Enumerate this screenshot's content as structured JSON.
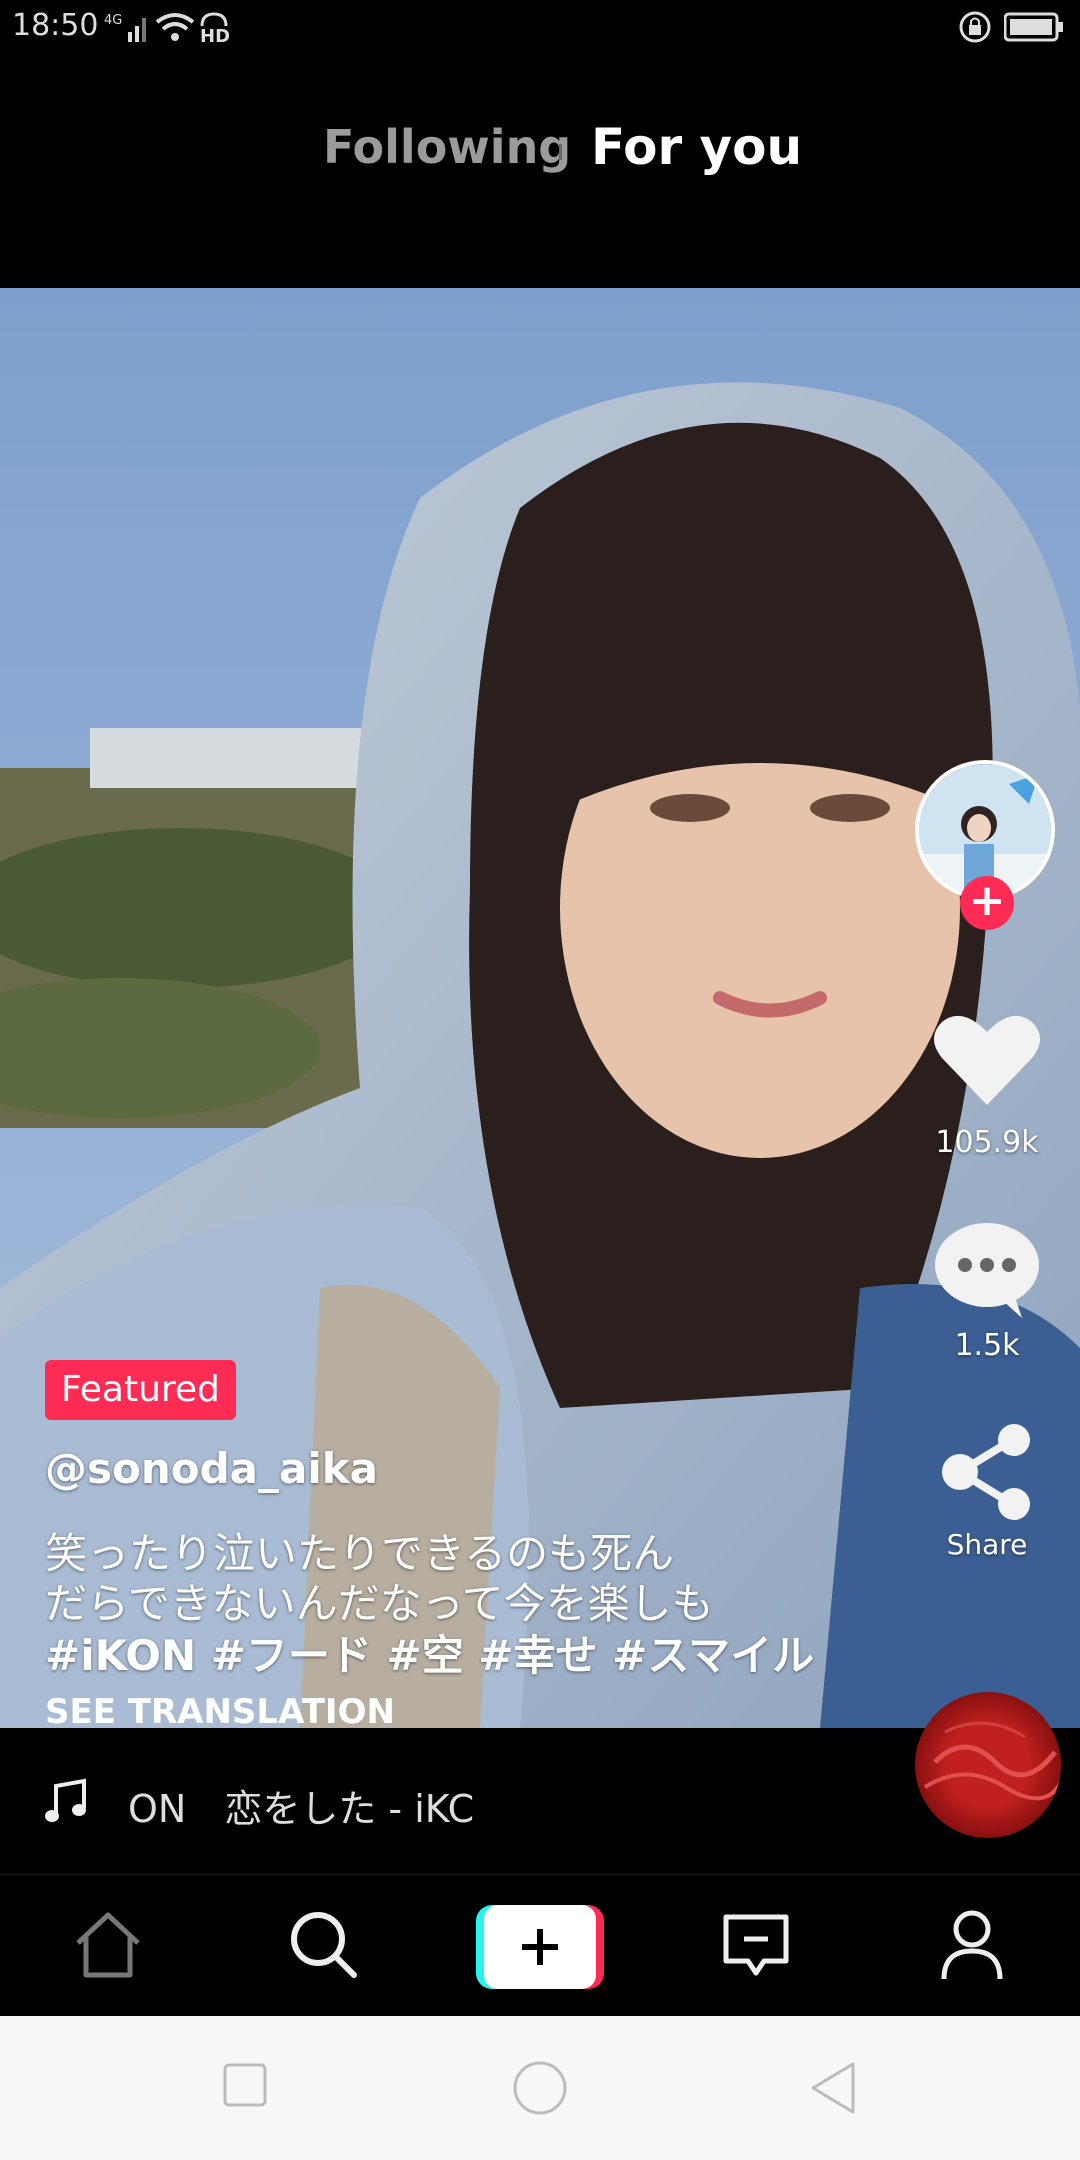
{
  "status_bar": {
    "time": "18:50",
    "signal": "4G",
    "network_badge": "HD",
    "icons": [
      "signal-icon",
      "wifi-icon",
      "hd-icon",
      "rotation-lock-icon",
      "battery-icon"
    ]
  },
  "top_tabs": {
    "following": "Following",
    "for_you": "For you",
    "active": "For you"
  },
  "post": {
    "badge": "Featured",
    "username": "@sonoda_aika",
    "caption_lines": [
      "笑ったり泣いたりできるのも死ん",
      "だらできないんだなって今を楽しも",
      "#iKON #フード #空 #幸せ #スマイル"
    ],
    "see_translation": "SEE TRANSLATION",
    "music": "ON　恋をした - iKC"
  },
  "actions": {
    "likes": "105.9k",
    "comments": "1.5k",
    "share": "Share"
  },
  "bottom_nav": [
    "home-icon",
    "search-icon",
    "create-icon",
    "inbox-icon",
    "profile-icon"
  ],
  "colors": {
    "accent": "#fe2c55",
    "teal": "#25f4ee",
    "background": "#000000"
  }
}
